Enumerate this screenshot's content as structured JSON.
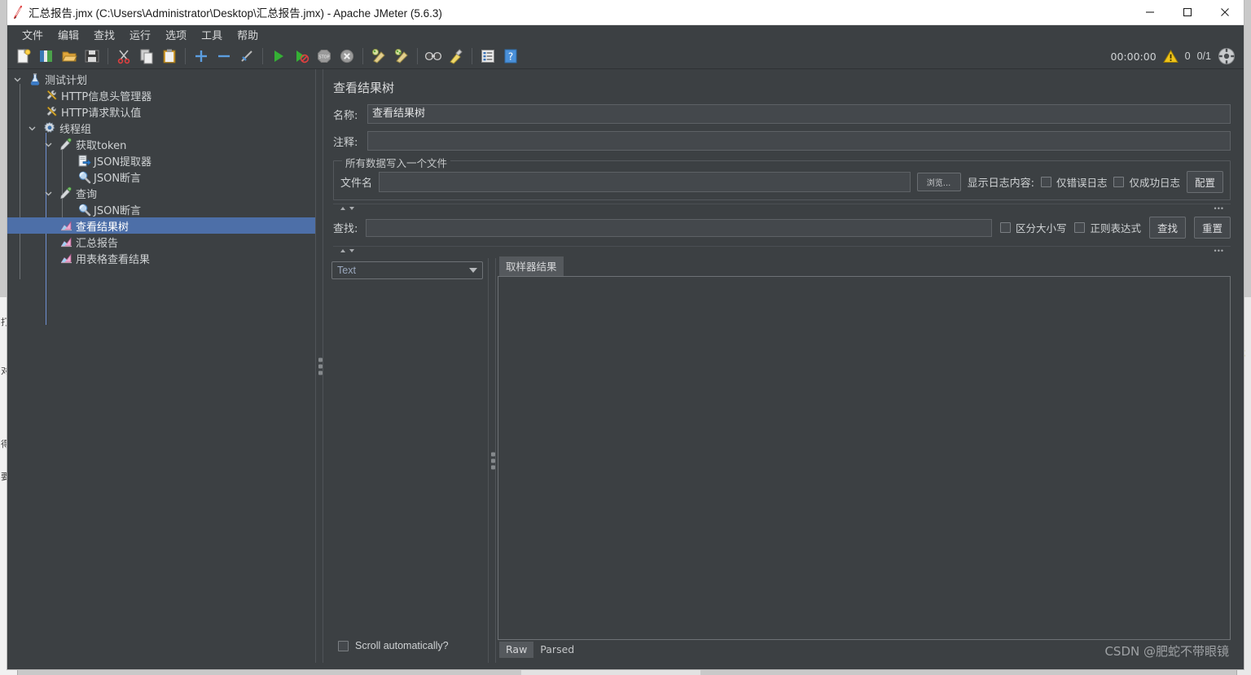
{
  "window": {
    "title": "汇总报告.jmx (C:\\Users\\Administrator\\Desktop\\汇总报告.jmx) - Apache JMeter (5.6.3)",
    "minimize_label": "—",
    "maximize_label": "☐",
    "close_label": "✕",
    "app_icon": "jmeter-feather-icon"
  },
  "menubar": {
    "items": [
      {
        "label": "文件",
        "name": "menu-file"
      },
      {
        "label": "编辑",
        "name": "menu-edit"
      },
      {
        "label": "查找",
        "name": "menu-search"
      },
      {
        "label": "运行",
        "name": "menu-run"
      },
      {
        "label": "选项",
        "name": "menu-options"
      },
      {
        "label": "工具",
        "name": "menu-tools"
      },
      {
        "label": "帮助",
        "name": "menu-help"
      }
    ]
  },
  "toolbar": {
    "buttons": [
      {
        "name": "new-icon",
        "title": "新建"
      },
      {
        "name": "templates-icon",
        "title": "模板"
      },
      {
        "name": "open-icon",
        "title": "打开"
      },
      {
        "name": "save-icon",
        "title": "保存"
      },
      {
        "name": "cut-icon",
        "title": "剪切"
      },
      {
        "name": "copy-icon",
        "title": "复制"
      },
      {
        "name": "paste-icon",
        "title": "粘贴"
      },
      {
        "name": "expand-icon",
        "title": "展开"
      },
      {
        "name": "collapse-icon",
        "title": "收起"
      },
      {
        "name": "toggle-icon",
        "title": "启用/禁用"
      },
      {
        "name": "start-icon",
        "title": "启动"
      },
      {
        "name": "start-no-pause-icon",
        "title": "无间隔启动"
      },
      {
        "name": "stop-icon",
        "title": "停止"
      },
      {
        "name": "shutdown-icon",
        "title": "关闭"
      },
      {
        "name": "clear-icon",
        "title": "清除"
      },
      {
        "name": "clear-all-icon",
        "title": "清除全部"
      },
      {
        "name": "search-icon",
        "title": "查找"
      },
      {
        "name": "reset-search-icon",
        "title": "重置查找"
      },
      {
        "name": "function-helper-icon",
        "title": "函数助手"
      },
      {
        "name": "help-icon",
        "title": "帮助"
      }
    ],
    "status": {
      "elapsed": "00:00:00",
      "warnings": "0",
      "threads": "0/1",
      "warning_icon": "warning-triangle-icon",
      "threads_icon": "remote-engine-icon"
    }
  },
  "tree": {
    "nodes": [
      {
        "label": "测试计划",
        "icon": "test-plan-icon",
        "depth": 0,
        "toggle": "expanded",
        "selected": false
      },
      {
        "label": "HTTP信息头管理器",
        "icon": "config-element-icon",
        "depth": 1,
        "toggle": "none",
        "selected": false
      },
      {
        "label": "HTTP请求默认值",
        "icon": "config-element-icon",
        "depth": 1,
        "toggle": "none",
        "selected": false
      },
      {
        "label": "线程组",
        "icon": "thread-group-icon",
        "depth": 1,
        "toggle": "expanded",
        "selected": false
      },
      {
        "label": "获取token",
        "icon": "http-sampler-icon",
        "depth": 2,
        "toggle": "expanded",
        "selected": false
      },
      {
        "label": "JSON提取器",
        "icon": "json-extractor-icon",
        "depth": 3,
        "toggle": "none",
        "selected": false
      },
      {
        "label": "JSON断言",
        "icon": "json-assertion-icon",
        "depth": 3,
        "toggle": "none",
        "selected": false
      },
      {
        "label": "查询",
        "icon": "http-sampler-icon",
        "depth": 2,
        "toggle": "expanded",
        "selected": false
      },
      {
        "label": "JSON断言",
        "icon": "json-assertion-icon",
        "depth": 3,
        "toggle": "none",
        "selected": false
      },
      {
        "label": "查看结果树",
        "icon": "listener-icon",
        "depth": 2,
        "toggle": "none",
        "selected": true
      },
      {
        "label": "汇总报告",
        "icon": "listener-icon",
        "depth": 2,
        "toggle": "none",
        "selected": false
      },
      {
        "label": "用表格查看结果",
        "icon": "listener-icon",
        "depth": 2,
        "toggle": "none",
        "selected": false
      }
    ]
  },
  "editor": {
    "title": "查看结果树",
    "name_label": "名称:",
    "name_value": "查看结果树",
    "comment_label": "注释:",
    "comment_value": "",
    "filegroup": {
      "title": "所有数据写入一个文件",
      "filename_label": "文件名",
      "filename_value": "",
      "browse_label": "浏览...",
      "log_display_label": "显示日志内容:",
      "errors_only_label": "仅错误日志",
      "errors_only_checked": false,
      "success_only_label": "仅成功日志",
      "success_only_checked": false,
      "configure_label": "配置"
    },
    "search": {
      "label": "查找:",
      "value": "",
      "case_label": "区分大小写",
      "case_checked": false,
      "regex_label": "正则表达式",
      "regex_checked": false,
      "find_label": "查找",
      "reset_label": "重置",
      "collapse_dots": "•••"
    },
    "results": {
      "renderer_value": "Text",
      "scroll_label": "Scroll automatically?",
      "scroll_checked": false,
      "tabs": [
        {
          "label": "取样器结果",
          "active": true
        }
      ],
      "bottom_tabs": [
        {
          "label": "Raw",
          "active": true
        },
        {
          "label": "Parsed",
          "active": false
        }
      ]
    }
  },
  "watermark": {
    "text": "CSDN @肥蛇不带眼镜"
  },
  "background": {
    "left_fragments": [
      "打",
      "对",
      "得!",
      "要"
    ],
    "right_fragments": [
      "部"
    ]
  },
  "colors": {
    "window_bg": "#3c4043",
    "selection": "#4d6fa8",
    "text": "#cfd2d4",
    "field_bg": "#44484c",
    "border": "#5d6165",
    "accent_green": "#4caf50",
    "accent_warning": "#ffc107"
  }
}
